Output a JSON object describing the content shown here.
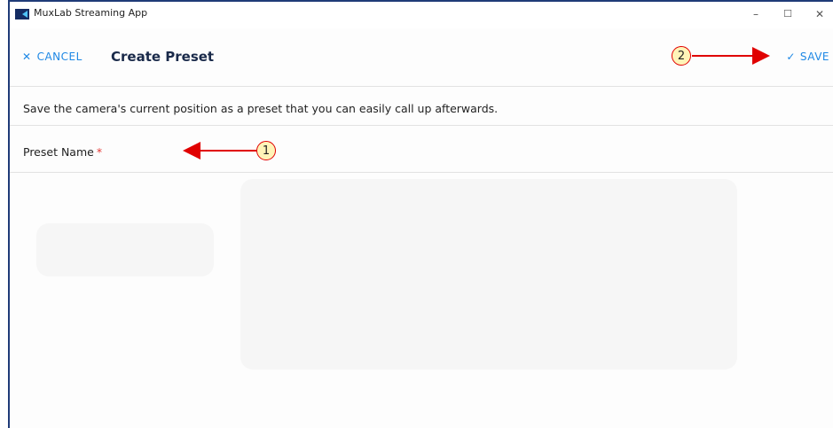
{
  "window": {
    "title": "MuxLab Streaming App",
    "controls": {
      "minimize": "–",
      "maximize": "☐",
      "close": "✕"
    }
  },
  "header": {
    "cancel_icon": "✕",
    "cancel_label": "CANCEL",
    "title": "Create Preset",
    "save_icon": "✓",
    "save_label": "SAVE"
  },
  "form": {
    "description": "Save the camera's current position as a preset that you can easily call up afterwards.",
    "preset_name_label": "Preset Name",
    "required_mark": "*",
    "preset_name_value": ""
  },
  "annotations": {
    "marker_1": "1",
    "marker_2": "2"
  },
  "colors": {
    "accent": "#1e88e5",
    "annotation_red": "#e00000",
    "title_text": "#1a2a4a",
    "window_border": "#1f3b78"
  }
}
